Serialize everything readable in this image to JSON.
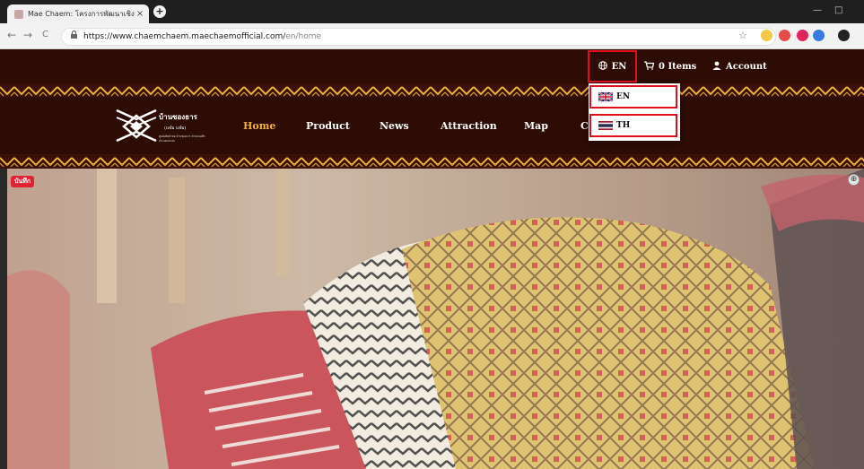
{
  "browser": {
    "tab_title": "Mae Chaem: โครงการพัฒนาเชิงพื้นที่",
    "tab_close": "×",
    "new_tab": "+",
    "url_host": "https://www.chaemchaem.maechaemofficial.com/",
    "url_path": "en/home",
    "back": "←",
    "forward": "→",
    "reload": "C",
    "bookmark_star": "☆",
    "minimize": "—",
    "maximize": "□"
  },
  "site_header": {
    "language_label": "EN",
    "language_icon": "globe-icon",
    "cart_label": "0 Items",
    "cart_icon": "cart-icon",
    "account_label": "Account",
    "account_icon": "user-icon"
  },
  "logo": {
    "line1": "บ้านซองธาร",
    "line2": "(แจ๋ม แจ๋ม)",
    "line3": "ศูนย์ผลิตผ้าทอ บ้านซองธาร ตำบลแม่ศึก อำเภอแม่แจ่ม"
  },
  "nav": {
    "items": [
      {
        "label": "Home",
        "active": true
      },
      {
        "label": "Product",
        "active": false
      },
      {
        "label": "News",
        "active": false
      },
      {
        "label": "Attraction",
        "active": false
      },
      {
        "label": "Map",
        "active": false
      },
      {
        "label": "Co",
        "active": false
      }
    ]
  },
  "language_dropdown": {
    "options": [
      {
        "label": "EN",
        "flag": "uk-flag-icon"
      },
      {
        "label": "TH",
        "flag": "thai-flag-icon"
      }
    ]
  },
  "hero": {
    "save_badge": "บันทึก",
    "zoom_icon": "⊕"
  },
  "colors": {
    "header_bg": "#2d0c05",
    "active_nav": "#f2b13a",
    "highlight_border": "#e0101a"
  }
}
